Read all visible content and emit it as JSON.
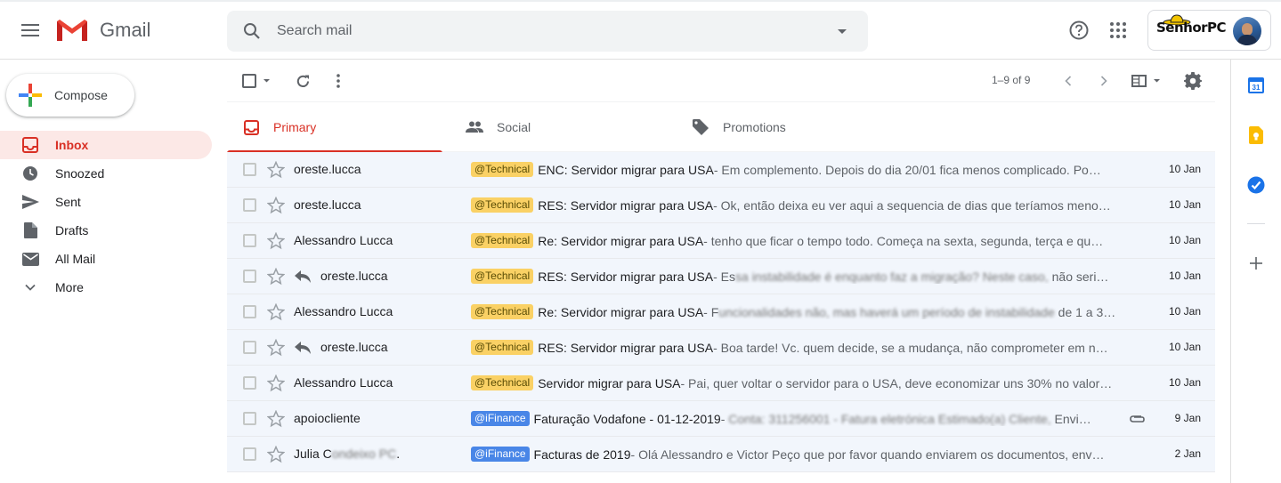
{
  "app": {
    "name": "Gmail"
  },
  "search": {
    "placeholder": "Search mail"
  },
  "account": {
    "brand": "SenhorPC"
  },
  "compose": {
    "label": "Compose"
  },
  "nav": {
    "items": [
      {
        "label": "Inbox",
        "icon": "inbox-icon",
        "active": true
      },
      {
        "label": "Snoozed",
        "icon": "clock-icon"
      },
      {
        "label": "Sent",
        "icon": "send-icon"
      },
      {
        "label": "Drafts",
        "icon": "draft-icon"
      },
      {
        "label": "All Mail",
        "icon": "mail-icon"
      },
      {
        "label": "More",
        "icon": "chevron-down-icon"
      }
    ]
  },
  "toolbar": {
    "pager": "1–9 of 9"
  },
  "tabs": [
    {
      "label": "Primary",
      "icon": "inbox-icon",
      "active": true
    },
    {
      "label": "Social",
      "icon": "people-icon"
    },
    {
      "label": "Promotions",
      "icon": "tag-icon"
    }
  ],
  "emails": [
    {
      "sender": "oreste.lucca",
      "replied": false,
      "label": "@Technical",
      "label_type": "tech",
      "subject": "ENC: Servidor migrar para USA",
      "snippet_prefix": " - Em complemento. Depois do dia 20/01 fica menos complicado. Po…",
      "date": "10 Jan"
    },
    {
      "sender": "oreste.lucca",
      "replied": false,
      "label": "@Technical",
      "label_type": "tech",
      "subject": "RES: Servidor migrar para USA",
      "snippet_prefix": " - Ok, então deixa eu ver aqui a sequencia de dias que teríamos meno…",
      "date": "10 Jan"
    },
    {
      "sender": "Alessandro Lucca",
      "replied": false,
      "label": "@Technical",
      "label_type": "tech",
      "subject": "Re: Servidor migrar para USA",
      "snippet_prefix": " - tenho que ficar o tempo todo. Começa na sexta, segunda, terça e qu…",
      "date": "10 Jan"
    },
    {
      "sender": "oreste.lucca",
      "replied": true,
      "label": "@Technical",
      "label_type": "tech",
      "subject": "RES: Servidor migrar para USA",
      "snippet_prefix": " - Es",
      "snippet_blur": "sa instabilidade é enquanto faz a migração? Neste caso,",
      "snippet_suffix": " não seri…",
      "date": "10 Jan"
    },
    {
      "sender": "Alessandro Lucca",
      "replied": false,
      "label": "@Technical",
      "label_type": "tech",
      "subject": "Re: Servidor migrar para USA",
      "snippet_prefix": " - F",
      "snippet_blur": "uncionalidades não, mas haverá um período de instabilidade",
      "snippet_suffix": " de 1 a 3…",
      "date": "10 Jan"
    },
    {
      "sender": "oreste.lucca",
      "replied": true,
      "label": "@Technical",
      "label_type": "tech",
      "subject": "RES: Servidor migrar para USA",
      "snippet_prefix": " - Boa tarde! Vc. quem decide, se a mudança, não comprometer em n…",
      "date": "10 Jan"
    },
    {
      "sender": "Alessandro Lucca",
      "replied": false,
      "label": "@Technical",
      "label_type": "tech",
      "subject": "Servidor migrar para USA",
      "snippet_prefix": " - Pai, quer voltar o servidor para o USA, deve economizar uns 30% no valor…",
      "date": "10 Jan"
    },
    {
      "sender": "apoiocliente",
      "replied": false,
      "label": "@iFinance",
      "label_type": "fin",
      "subject": "Faturação Vodafone - 01-12-2019",
      "snippet_prefix": " - ",
      "snippet_blur": "Conta: 311256001 - Fatura eletrónica Estimado(a) Cliente,",
      "snippet_suffix": " Envia…",
      "date": "9 Jan",
      "attachment": true
    },
    {
      "sender": "Julia C",
      "sender_blur": "ondeixo PC",
      "sender_suffix": ".",
      "replied": false,
      "label": "@iFinance",
      "label_type": "fin",
      "subject": "Facturas de 2019",
      "snippet_prefix": " - Olá Alessandro e Victor Peço que por favor quando enviarem os documentos, env…",
      "date": "2 Jan"
    }
  ],
  "colors": {
    "accent": "#d93025",
    "active_bg": "#fce8e6",
    "row_bg": "#f2f6fc",
    "tech_label": "#fad165",
    "finance_label": "#4986e7"
  }
}
